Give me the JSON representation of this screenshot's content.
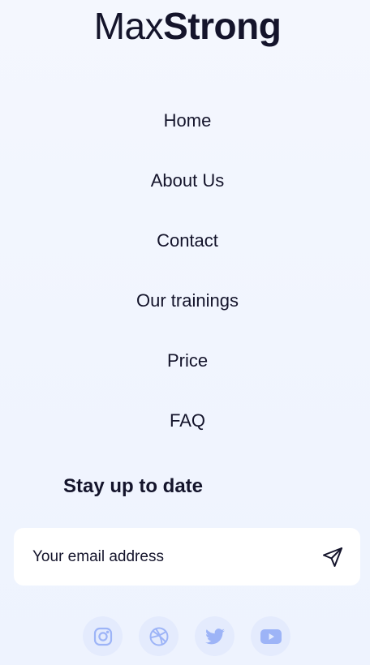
{
  "brand": {
    "name_light": "Max",
    "name_bold": "Strong"
  },
  "nav": {
    "items": [
      {
        "label": "Home"
      },
      {
        "label": "About Us"
      },
      {
        "label": "Contact"
      },
      {
        "label": "Our trainings"
      },
      {
        "label": "Price"
      },
      {
        "label": "FAQ"
      }
    ]
  },
  "newsletter": {
    "title": "Stay up to date",
    "placeholder": "Your email address",
    "send_icon": "send-icon"
  },
  "socials": [
    {
      "icon": "instagram-icon"
    },
    {
      "icon": "dribbble-icon"
    },
    {
      "icon": "twitter-icon"
    },
    {
      "icon": "youtube-icon"
    }
  ],
  "colors": {
    "text": "#14142b",
    "background": "#f4f7fe",
    "social_bg": "#e4ebfd",
    "social_icon": "#9db4f7"
  }
}
